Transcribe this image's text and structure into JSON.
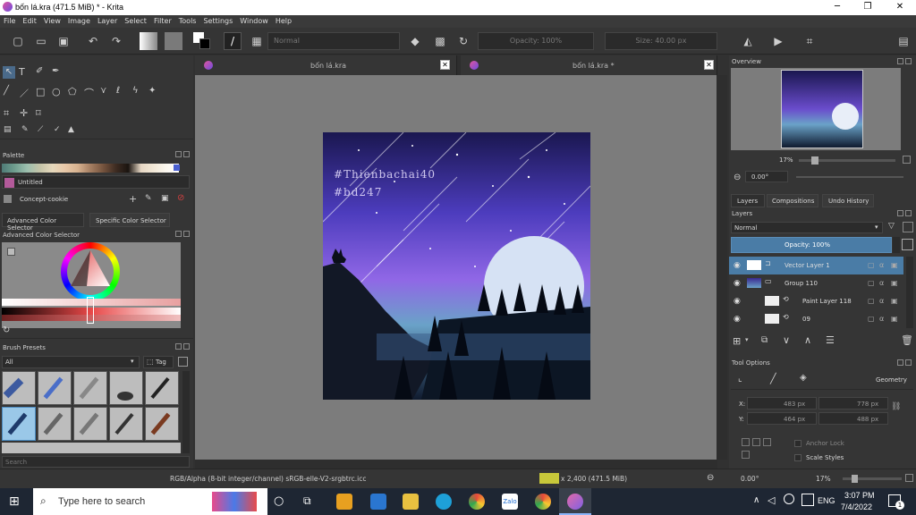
{
  "window": {
    "title": "bốn lá.kra (471.5 MiB)  * - Krita",
    "min": "─",
    "max": "❐",
    "close": "✕"
  },
  "menu": [
    "File",
    "Edit",
    "View",
    "Image",
    "Layer",
    "Select",
    "Filter",
    "Tools",
    "Settings",
    "Window",
    "Help"
  ],
  "toolbar": {
    "blend_mode": "Normal",
    "opacity": "Opacity: 100%",
    "size": "Size: 40.00 px"
  },
  "left": {
    "palette_title": "Palette",
    "palette_name": "Untitled",
    "palette_set": "Concept-cookie",
    "color_tabs": [
      "Advanced Color Selector",
      "Specific Color Selector"
    ],
    "acs_title": "Advanced Color Selector",
    "brush_title": "Brush Presets",
    "brush_filter": "All",
    "brush_tag": "Tag",
    "search_placeholder": "Search"
  },
  "tabs": [
    {
      "label": "bốn lá.kra"
    },
    {
      "label": "bốn lá.kra *"
    }
  ],
  "artwork": {
    "text_line1": "#Thienbachai40",
    "text_line2": "#bd247"
  },
  "right": {
    "overview_title": "Overview",
    "zoom": "17%",
    "rotation": "0.00°",
    "panel_tabs": [
      "Layers",
      "Compositions",
      "Undo History"
    ],
    "layers_title": "Layers",
    "blend": "Normal",
    "opacity": "Opacity:  100%",
    "layers": [
      {
        "name": "Vector Layer 1",
        "selected": true
      },
      {
        "name": "Group 110",
        "selected": false
      },
      {
        "name": "Paint Layer 118",
        "selected": false
      },
      {
        "name": "09",
        "selected": false
      }
    ],
    "tool_options_title": "Tool Options",
    "geometry": "Geometry",
    "x_label": "X:",
    "y_label": "Y:",
    "x_val": "483 px",
    "y_val": "464 px",
    "w_val": "778 px",
    "h_val": "488 px",
    "anchor_lock": "Anchor Lock",
    "scale_styles": "Scale Styles"
  },
  "status": {
    "color_space": "RGB/Alpha (8-bit integer/channel)  sRGB-elle-V2-srgbtrc.icc",
    "size_info": "x 2,400 (471.5 MiB)",
    "rotation": "0.00°",
    "zoom": "17%"
  },
  "taskbar": {
    "search": "Type here to search",
    "time": "3:07 PM",
    "date": "7/4/2022",
    "lang": "ENG",
    "notif": "1"
  }
}
